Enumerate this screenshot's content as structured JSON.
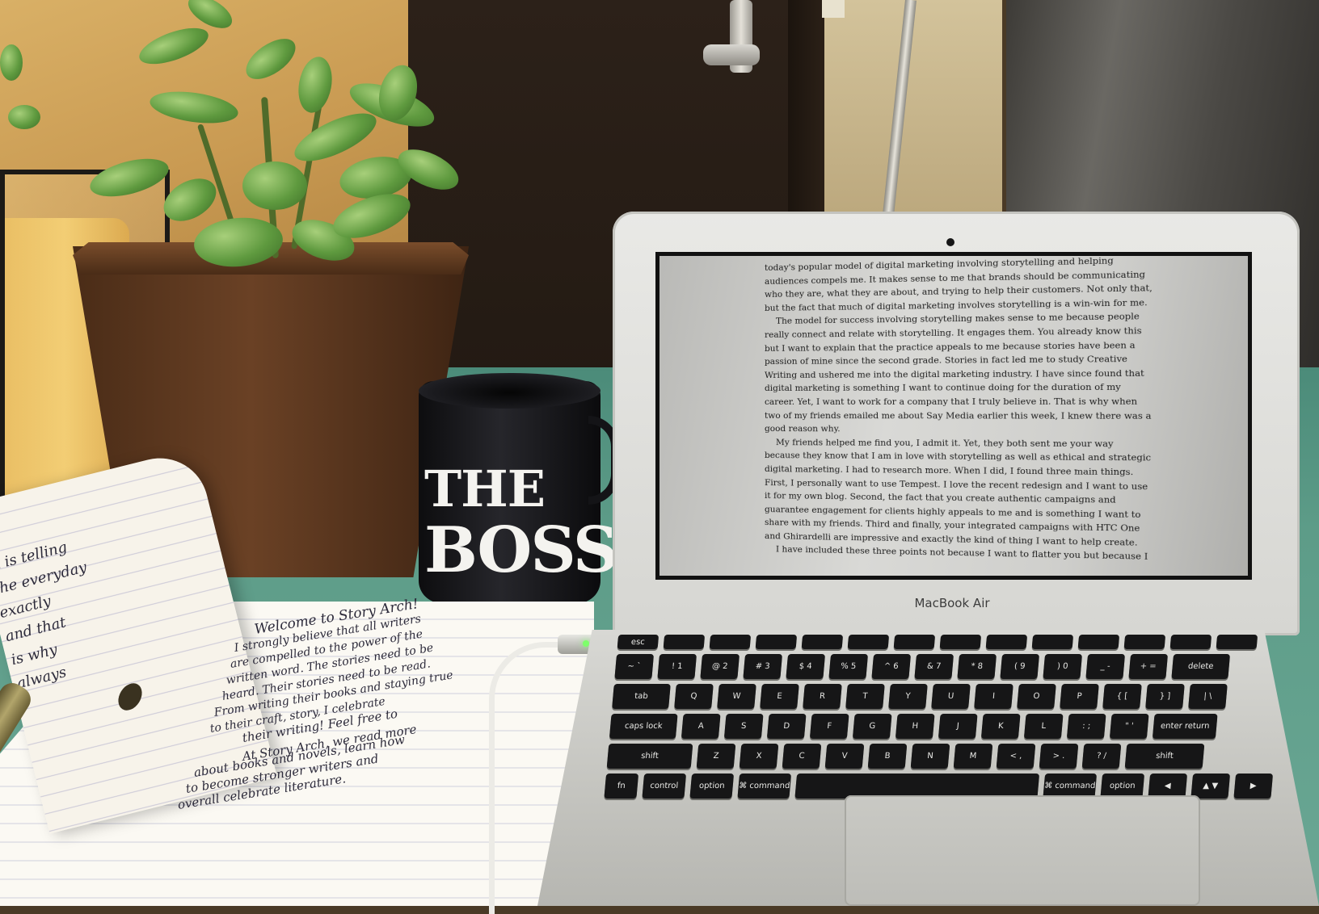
{
  "scene": {
    "mug_text": [
      "THE",
      "BOSS"
    ],
    "laptop_brand": "MacBook Air",
    "handwritten_lines": [
      "Welcome to Story Arch!",
      "I strongly believe that all writers",
      "are compelled to the power of the",
      "written word. The stories need to be",
      "heard. Their stories need to be read.",
      "From writing their books and staying true",
      "to their craft, story, I celebrate",
      "their writing! Feel free to",
      "At Story Arch, we read more",
      "about books and novels, learn how",
      "to become stronger writers and",
      "overall celebrate literature."
    ],
    "left_page_fragments": [
      "n is telling",
      "the everyday",
      "exactly",
      "and that",
      "is why",
      "always"
    ]
  },
  "document": {
    "paragraphs": [
      "today's popular model of digital marketing involving storytelling and helping audiences compels me. It makes sense to me that brands should be communicating who they are, what they are about, and trying to help their customers. Not only that, but the fact that much of digital marketing involves storytelling is a win-win for me.",
      "The model for success involving storytelling makes sense to me because people really connect and relate with storytelling. It engages them. You already know this but I want to explain that the practice appeals to me because stories have been a passion of mine since the second grade. Stories in fact led me to study Creative Writing and ushered me into the digital marketing industry. I have since found that digital marketing is something I want to continue doing for the duration of my career. Yet, I want to work for a company that I truly believe in. That is why when two of my friends emailed me about Say Media earlier this week, I knew there was a good reason why.",
      "My friends helped me find you, I admit it. Yet, they both sent me your way because they know that I am in love with storytelling as well as ethical and strategic digital marketing. I had to research more. When I did, I found three main things. First, I personally want to use Tempest. I love the recent redesign and I want to use it for my own blog. Second, the fact that you create authentic campaigns and guarantee engagement for clients highly appeals to me and is something I want to share with my friends. Third and finally, your integrated campaigns with HTC One and Ghirardelli are impressive and exactly the kind of thing I want to help create.",
      "I have included these three points not because I want to flatter you but because I"
    ]
  },
  "keyboard": {
    "fn_row": [
      "esc",
      "",
      "",
      "",
      "",
      "",
      "",
      "",
      "",
      "",
      "",
      "",
      "",
      ""
    ],
    "number_row": [
      "~ `",
      "! 1",
      "@ 2",
      "# 3",
      "$ 4",
      "% 5",
      "^ 6",
      "& 7",
      "* 8",
      "( 9",
      ") 0",
      "_ -",
      "+ =",
      "delete"
    ],
    "top_row": [
      "tab",
      "Q",
      "W",
      "E",
      "R",
      "T",
      "Y",
      "U",
      "I",
      "O",
      "P",
      "{ [",
      "} ]",
      "| \\"
    ],
    "home_row": [
      "caps lock",
      "A",
      "S",
      "D",
      "F",
      "G",
      "H",
      "J",
      "K",
      "L",
      ": ;",
      "\" '",
      "enter return"
    ],
    "bottom_row": [
      "shift",
      "Z",
      "X",
      "C",
      "V",
      "B",
      "N",
      "M",
      "< ,",
      "> .",
      "? /",
      "shift"
    ],
    "mod_row": [
      "fn",
      "control",
      "option",
      "⌘ command",
      "",
      "⌘ command",
      "option",
      "◀",
      "▲ ▼",
      "▶"
    ]
  },
  "colors": {
    "table": "#5d9c88",
    "mug": "#111114",
    "laptop": "#d6d6d2",
    "keys": "#161617"
  }
}
